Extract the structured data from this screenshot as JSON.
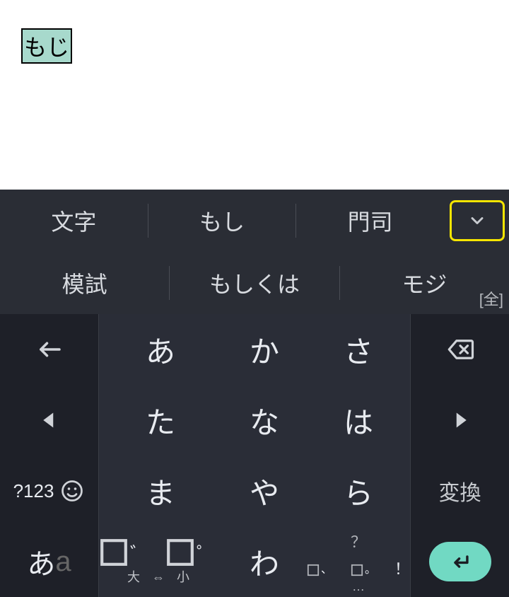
{
  "input": {
    "composing": "もじ"
  },
  "suggestions": {
    "row1": [
      "文字",
      "もし",
      "門司"
    ],
    "row2": [
      "模試",
      "もしくは",
      "モジ"
    ],
    "mode_indicator": "[全]"
  },
  "keys": {
    "a": "あ",
    "ka": "か",
    "sa": "さ",
    "ta": "た",
    "na": "な",
    "ha": "は",
    "ma": "ま",
    "ya": "や",
    "ra": "ら",
    "wa": "わ",
    "henkan": "変換",
    "sym123": "?123",
    "aa_primary": "あ",
    "aa_secondary": "a",
    "size_marks_1": "゛",
    "size_marks_2": "゜",
    "size_label": "大 ⇔ 小",
    "punct_q": "？",
    "punct_ex": "！",
    "punct_ten": "、",
    "punct_maru": "。",
    "punct_dots": "…"
  }
}
